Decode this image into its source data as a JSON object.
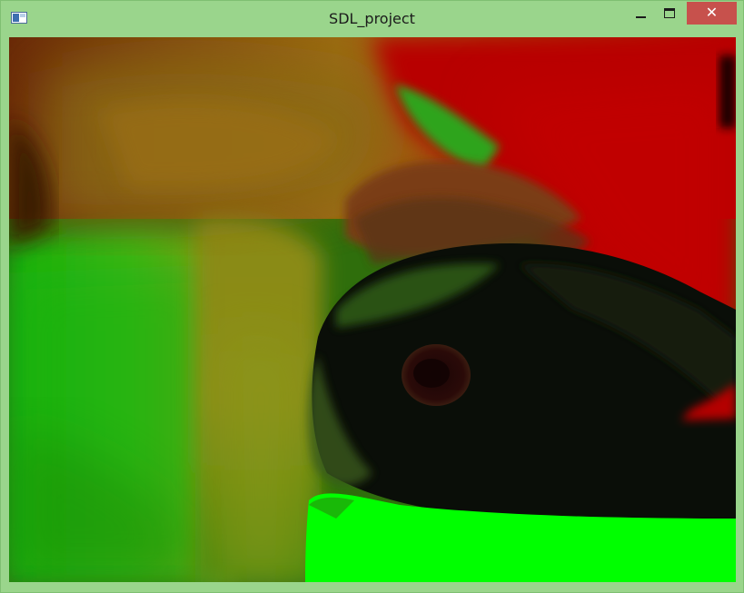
{
  "window": {
    "title": "SDL_project",
    "controls": {
      "minimize": "minimize",
      "maximize": "maximize",
      "close": "close"
    }
  },
  "canvas": {
    "content": "rendered-frame",
    "palette": {
      "red": "#c20000",
      "green": "#00ff00",
      "dark": "#050805",
      "olive": "#7a7a10",
      "frame": "#9ad58c",
      "close": "#c7514c"
    }
  }
}
